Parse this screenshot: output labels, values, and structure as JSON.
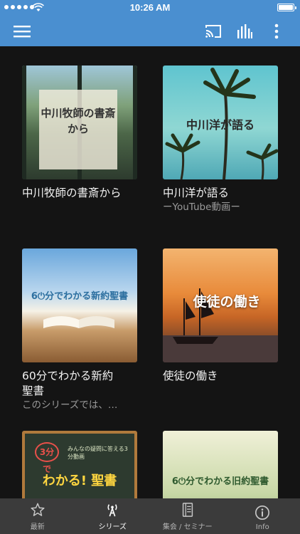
{
  "status_bar": {
    "time": "10:26 AM"
  },
  "app_bar": {
    "icons": [
      "hamburger-menu-icon",
      "cast-icon",
      "equalizer-icon",
      "more-vertical-icon"
    ]
  },
  "colors": {
    "primary": "#4a8fd0",
    "background": "#141414",
    "tab_bar": "#3b3b3b"
  },
  "series": [
    {
      "title": "中川牧師の書斎から",
      "subtitle": "",
      "thumb_text": "中川牧師の書斎から"
    },
    {
      "title": "中川洋が語る",
      "subtitle": "ーYouTube動画ー",
      "thumb_text": "中川洋が語る"
    },
    {
      "title": "60分でわかる新約聖書",
      "subtitle": "このシリーズでは、…",
      "thumb_text": "6⏻分でわかる新約聖書"
    },
    {
      "title": "使徒の働き",
      "subtitle": "",
      "thumb_text": "使徒の働き"
    },
    {
      "title": "",
      "subtitle": "",
      "thumb_text": "わかる! 聖書",
      "thumb_badge": "3分で",
      "thumb_small": "みんなの疑問に答える3分動画"
    },
    {
      "title": "",
      "subtitle": "",
      "thumb_text": "6⏻分でわかる旧約聖書"
    }
  ],
  "tabs": [
    {
      "label": "最新",
      "icon": "star-icon",
      "active": false
    },
    {
      "label": "シリーズ",
      "icon": "broadcast-icon",
      "active": true
    },
    {
      "label": "集会 / セミナー",
      "icon": "book-icon",
      "active": false
    },
    {
      "label": "Info",
      "icon": "info-icon",
      "active": false
    }
  ]
}
